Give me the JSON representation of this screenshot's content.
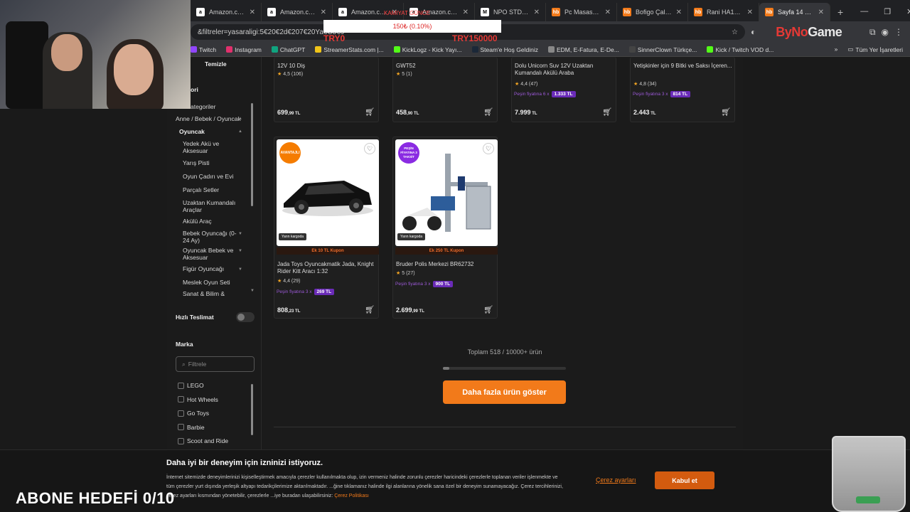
{
  "tabs": [
    {
      "label": "Amazon.com.tr",
      "fav": "a",
      "color": "#ffffff"
    },
    {
      "label": "Amazon.com.tr",
      "fav": "a",
      "color": "#ffffff"
    },
    {
      "label": "Amazon.com.tr",
      "fav": "a",
      "color": "#ffffff"
    },
    {
      "label": "Amazon.com.tr",
      "fav": "a",
      "color": "#ffffff"
    },
    {
      "label": "NPO STD191LV",
      "fav": "M",
      "color": "#ffffff"
    },
    {
      "label": "Pc Masası Fiyat",
      "fav": "hb",
      "color": "#f27a1a"
    },
    {
      "label": "Bofigo Çalışma",
      "fav": "hb",
      "color": "#f27a1a"
    },
    {
      "label": "Rani HA122 LE",
      "fav": "hb",
      "color": "#f27a1a"
    },
    {
      "label": "Sayfa 14 – oyu",
      "fav": "hb",
      "color": "#f27a1a",
      "active": true
    }
  ],
  "url": "&filtreler=yasaraligi:5€20€2d€207€20Ya€C5€9",
  "brand_overlay": {
    "part1": "ByNo",
    "part2": "Game"
  },
  "bookmarks": [
    "Twitch",
    "Instagram",
    "ChatGPT",
    "StreamerStats.com |...",
    "KickLogz - Kick Yayı...",
    "Steam'e Hoş Geldiniz",
    "EDM, E-Fatura, E-De...",
    "SinnerClown Türkçe...",
    "Kick / Twitch VOD d..."
  ],
  "bookmarks_all": "Tüm Yer İşaretleri",
  "donation": {
    "text": "150₺ (0.10%)",
    "top": "KAMIYAT GÜNCE",
    "left": "TRY0",
    "right": "TRY150000"
  },
  "sidebar": {
    "clear": "Temizle",
    "category_heading": "ori",
    "all_categories": "ategoriler",
    "parent": "Anne / Bebek / Oyuncak",
    "current": "Oyuncak",
    "subs": [
      "Yedek Akü ve Aksesuar",
      "Yarış Pisti",
      "Oyun Çadırı ve Evi",
      "Parçalı Setler",
      "Uzaktan Kumandalı Araçlar",
      "Akülü Araç",
      "Bebek Oyuncağı (0-24 Ay)",
      "Oyuncak Bebek ve Aksesuar",
      "Figür Oyuncağı",
      "Meslek Oyun Seti",
      "Sanat & Bilim &"
    ],
    "fast_delivery": "Hızlı Teslimat",
    "brand_heading": "Marka",
    "filter_placeholder": "Filtrele",
    "brands": [
      "LEGO",
      "Hot Wheels",
      "Go Toys",
      "Barbie",
      "Scoot and Ride"
    ]
  },
  "top_cards": [
    {
      "title": "12V 10 Diş",
      "rating": "4,5",
      "count": "(106)",
      "price_main": "699",
      "price_dec": ",99 TL"
    },
    {
      "title": "GWT52",
      "rating": "5",
      "count": "(1)",
      "price_main": "458",
      "price_dec": ",90 TL"
    },
    {
      "title": "Dolu Unicorn Suv 12V Uzaktan Kumandalı Akülü Araba",
      "rating": "4,4",
      "count": "(47)",
      "inst_label": "Peşin fiyatına 6 x",
      "inst_amt": "1.333 TL",
      "price_main": "7.999",
      "price_dec": " TL"
    },
    {
      "title": "Yetişkinler için 9 Bitki ve Saksı İçeren...",
      "rating": "4,8",
      "count": "(34)",
      "inst_label": "Peşin fiyatına 3 x",
      "inst_amt": "814 TL",
      "price_main": "2.443",
      "price_dec": " TL"
    }
  ],
  "cards": [
    {
      "badge": "AVANTAJLI",
      "cargo": "Yarın kargoda",
      "coupon": "Ek 10 TL Kupon",
      "title": "Jada Toys Oyuncakmatik Jada, Knight Rider Kitt Aracı 1:32",
      "rating": "4,4",
      "count": "(29)",
      "inst_label": "Peşin fiyatına 3 x",
      "inst_amt": "269 TL",
      "price_main": "808",
      "price_dec": ",23 TL"
    },
    {
      "badge": "PEŞİN FİYATINA 3 TAKSİT",
      "cargo": "Yarın kargoda",
      "coupon": "Ek 250 TL Kupon",
      "title": "Bruder Polis Merkezi BR62732",
      "rating": "5",
      "count": "(27)",
      "inst_label": "Peşin fiyatına 3 x",
      "inst_amt": "900 TL",
      "price_main": "2.699",
      "price_dec": ",99 TL"
    }
  ],
  "total": "Toplam 518 / 10000+ ürün",
  "progress_fraction": 0.05,
  "more_button": "Daha fazla ürün göster",
  "cookie": {
    "title": "Daha iyi bir deneyim için izninizi istiyoruz.",
    "body": "İnternet sitemizde deneyimlerinizi kişiselleştirmek amacıyla çerezler kullanılmakta olup, izin vermeniz halinde zorunlu çerezler haricindeki çerezlerle toplanan veriler işlenmekte ve tüm çerezler yurt dışında yerleşik altyapı tedarikçilerimize aktarılmaktadır. ...ğine tıklamanız halinde ilgi alanlarına yönelik sana özel bir deneyim sunamayacağız. Çerez tercihlerinizi, çerez ayarları kısmından yönetebilir, çerezlerle ...iye buradan ulaşabilirsiniz:",
    "policy_link": "Çerez Politikası",
    "settings": "Çerez ayarları",
    "accept": "Kabul et"
  },
  "sub_goal": "ABONE HEDEFİ 0/10"
}
